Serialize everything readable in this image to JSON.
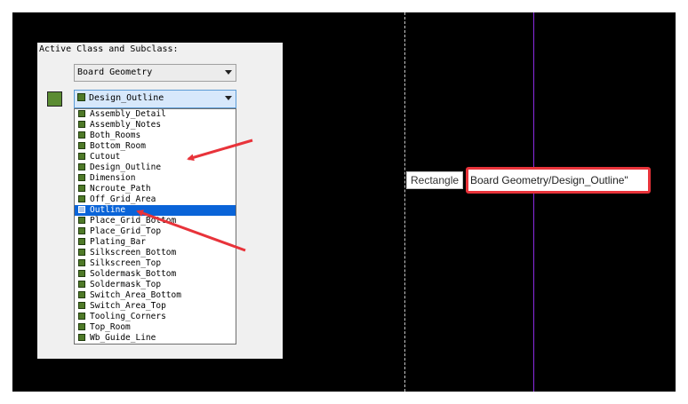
{
  "panel": {
    "title": "Active Class and Subclass:",
    "class_select": {
      "value": "Board Geometry"
    },
    "subclass_select": {
      "value": "Design_Outline"
    },
    "subclass_color": "#5b8c33"
  },
  "subclass_list": {
    "items": [
      "Assembly_Detail",
      "Assembly_Notes",
      "Both_Rooms",
      "Bottom_Room",
      "Cutout",
      "Design_Outline",
      "Dimension",
      "Ncroute_Path",
      "Off_Grid_Area",
      "Outline",
      "Place_Grid_Bottom",
      "Place_Grid_Top",
      "Plating_Bar",
      "Silkscreen_Bottom",
      "Silkscreen_Top",
      "Soldermask_Bottom",
      "Soldermask_Top",
      "Switch_Area_Bottom",
      "Switch_Area_Top",
      "Tooling_Corners",
      "Top_Room",
      "Wb_Guide_Line"
    ],
    "selected": "Outline"
  },
  "tooltip": {
    "label": "Rectangle",
    "value": "Board Geometry/Design_Outline\""
  },
  "colors": {
    "canvas_background": "#000000",
    "annotation_red": "#e8333a",
    "guide_purple": "#8a2be2",
    "selection_blue": "#0a64d8"
  }
}
